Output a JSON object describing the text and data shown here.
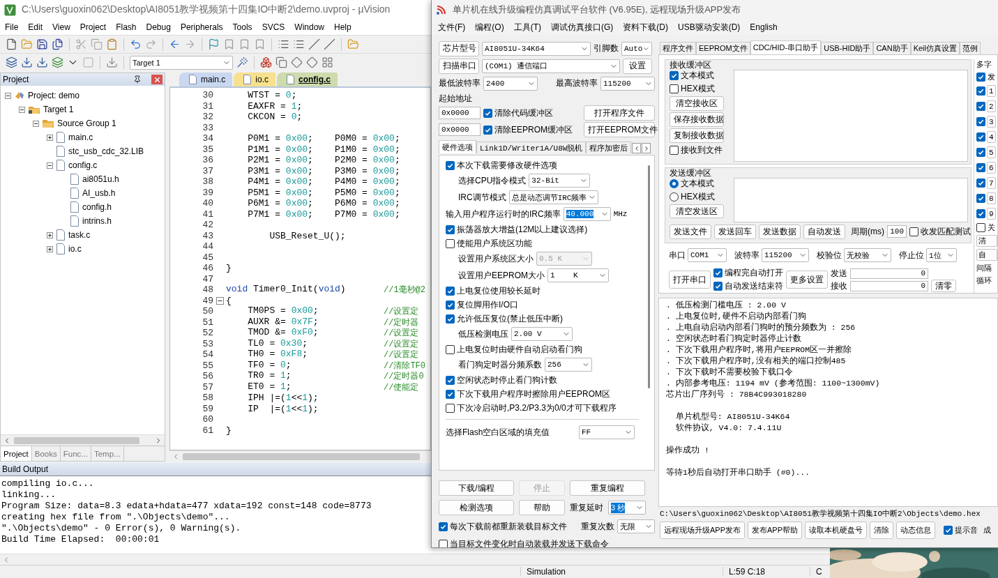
{
  "ide": {
    "title": "C:\\Users\\guoxin062\\Desktop\\AI8051教学视频第十四集IO中断2\\demo.uvproj - µVision",
    "menu": [
      "File",
      "Edit",
      "View",
      "Project",
      "Flash",
      "Debug",
      "Peripherals",
      "Tools",
      "SVCS",
      "Window",
      "Help"
    ],
    "target": "Target 1",
    "project_panel": {
      "title": "Project",
      "tree": [
        {
          "label": "Project: demo",
          "kind": "project",
          "expanded": true,
          "children": [
            {
              "label": "Target 1",
              "kind": "target",
              "expanded": true,
              "children": [
                {
                  "label": "Source Group 1",
                  "kind": "group",
                  "expanded": true,
                  "children": [
                    {
                      "label": "main.c",
                      "kind": "file",
                      "expanded": false
                    },
                    {
                      "label": "stc_usb_cdc_32.LIB",
                      "kind": "file"
                    },
                    {
                      "label": "config.c",
                      "kind": "file",
                      "expanded": true,
                      "children": [
                        {
                          "label": "ai8051u.h",
                          "kind": "file"
                        },
                        {
                          "label": "AI_usb.h",
                          "kind": "file"
                        },
                        {
                          "label": "config.h",
                          "kind": "file"
                        },
                        {
                          "label": "intrins.h",
                          "kind": "file"
                        }
                      ]
                    },
                    {
                      "label": "task.c",
                      "kind": "file",
                      "expanded": false
                    },
                    {
                      "label": "io.c",
                      "kind": "file",
                      "expanded": false
                    }
                  ]
                }
              ]
            }
          ]
        }
      ],
      "tabs": [
        {
          "label": "Project",
          "selected": true
        },
        {
          "label": "Books",
          "selected": false
        },
        {
          "label": "Func...",
          "selected": false
        },
        {
          "label": "Temp...",
          "selected": false
        }
      ]
    },
    "editor_tabs": [
      {
        "label": "main.c",
        "selected": false,
        "color": "#c9d8f0"
      },
      {
        "label": "io.c",
        "selected": false,
        "color": "#f7e08e"
      },
      {
        "label": "config.c",
        "selected": true,
        "color": "#cddbad"
      }
    ],
    "code_lines": [
      {
        "number": "30",
        "code": "    WTST = 0;"
      },
      {
        "number": "31",
        "code": "    EAXFR = 1;"
      },
      {
        "number": "32",
        "code": "    CKCON = 0;"
      },
      {
        "number": "33"
      },
      {
        "number": "34",
        "code": "    P0M1 = 0x00;    P0M0 = 0x00;"
      },
      {
        "number": "35",
        "code": "    P1M1 = 0x00;    P1M0 = 0x00;"
      },
      {
        "number": "36",
        "code": "    P2M1 = 0x00;    P2M0 = 0x00;"
      },
      {
        "number": "37",
        "code": "    P3M1 = 0x00;    P3M0 = 0x00;"
      },
      {
        "number": "38",
        "code": "    P4M1 = 0x00;    P4M0 = 0x00;"
      },
      {
        "number": "39",
        "code": "    P5M1 = 0x00;    P5M0 = 0x00;"
      },
      {
        "number": "40",
        "code": "    P6M1 = 0x00;    P6M0 = 0x00;"
      },
      {
        "number": "41",
        "code": "    P7M1 = 0x00;    P7M0 = 0x00;"
      },
      {
        "number": "42"
      },
      {
        "number": "43",
        "code": "        USB_Reset_U();"
      },
      {
        "number": "44"
      },
      {
        "number": "45"
      },
      {
        "number": "46",
        "code": "}"
      },
      {
        "number": "47"
      },
      {
        "number": "48",
        "tokens": [
          {
            "kind": "keyword",
            "text": "void"
          },
          {
            "kind": "plain",
            "text": " Timer0_Init("
          },
          {
            "kind": "keyword",
            "text": "void"
          },
          {
            "kind": "plain",
            "text": ")"
          }
        ],
        "comment": "//1毫秒@2"
      },
      {
        "number": "49",
        "code": "{",
        "folded": false
      },
      {
        "number": "50",
        "code": "    TM0PS = 0x00;",
        "comment": "//设置定"
      },
      {
        "number": "51",
        "code": "    AUXR &= 0x7F;",
        "comment": "//定时器"
      },
      {
        "number": "52",
        "code": "    TMOD &= 0xF0;",
        "comment": "//设置定"
      },
      {
        "number": "53",
        "code": "    TL0 = 0x30;",
        "comment": "//设置定"
      },
      {
        "number": "54",
        "code": "    TH0 = 0xF8;",
        "comment": "//设置定"
      },
      {
        "number": "55",
        "code": "    TF0 = 0;",
        "comment": "//清除TF0"
      },
      {
        "number": "56",
        "code": "    TR0 = 1;",
        "comment": "//定时器0"
      },
      {
        "number": "57",
        "code": "    ET0 = 1;",
        "comment": "//使能定"
      },
      {
        "number": "58",
        "code": "    IPH |=(1<<1);"
      },
      {
        "number": "59",
        "code": "    IP  |=(1<<1);"
      },
      {
        "number": "60"
      },
      {
        "number": "61",
        "code": "}"
      }
    ],
    "build_output": {
      "title": "Build Output",
      "lines": [
        "compiling io.c...",
        "linking...",
        "Program Size: data=8.3 edata+hdata=477 xdata=192 const=148 code=8773",
        "creating hex file from \".\\Objects\\demo\"...",
        "\".\\Objects\\demo\" - 0 Error(s), 0 Warning(s).",
        "Build Time Elapsed:  00:00:01"
      ]
    },
    "status_bar": [
      "Simulation",
      "L:59 C:18",
      "C"
    ]
  },
  "isp": {
    "title": "单片机在线升级编程仿真调试平台软件 (V6.95E), 远程现场升级APP发布",
    "menu": [
      "文件(F)",
      "编程(O)",
      "工具(T)",
      "调试仿真接口(G)",
      "资料下载(D)",
      "USB驱动安装(D)",
      "English"
    ],
    "chip": {
      "button": "芯片型号",
      "value": "AI8051U-34K64",
      "pins_label": "引脚数",
      "pins": "Auto"
    },
    "port": {
      "button": "扫描串口",
      "value": "(COM1) 通信端口",
      "settings": "设置"
    },
    "baud": {
      "min_label": "最低波特率",
      "min": "2400",
      "max_label": "最高波特率",
      "max": "115200"
    },
    "start_address": {
      "label": "起始地址",
      "rows": [
        {
          "value": "0x0000",
          "label": "清除代码缓冲区",
          "checked": true,
          "button": "打开程序文件"
        },
        {
          "value": "0x0000",
          "label": "清除EEPROM缓冲区",
          "checked": true,
          "button": "打开EEPROM文件"
        }
      ]
    },
    "option_tabs": [
      {
        "label": "硬件选项",
        "selected": true
      },
      {
        "label": "Link1D/Writer1A/U8W脱机",
        "selected": false
      },
      {
        "label": "程序加密后",
        "selected": false
      }
    ],
    "options": [
      {
        "kind": "check",
        "label": "本次下载需要修改硬件选项",
        "checked": true
      },
      {
        "kind": "select",
        "label": "选择CPU指令模式",
        "value": "32-Bit",
        "disabled": false,
        "highlighted": false
      },
      {
        "kind": "select",
        "label": "IRC调节模式",
        "value": "总是动态调节IRC频率",
        "disabled": false,
        "highlighted": false
      },
      {
        "kind": "select",
        "label": "输入用户程序运行时的IRC频率",
        "value": "40.000",
        "unit": "MHz",
        "disabled": false,
        "highlighted": true
      },
      {
        "kind": "check",
        "label": "振荡器放大增益(12M以上建议选择)",
        "checked": true
      },
      {
        "kind": "check",
        "label": "使能用户系统区功能",
        "checked": false
      },
      {
        "kind": "select",
        "label": "设置用户系统区大小",
        "value": "0.5 K",
        "disabled": true,
        "highlighted": false
      },
      {
        "kind": "select",
        "label": "设置用户EEPROM大小",
        "value": "1    K",
        "disabled": false,
        "highlighted": false
      },
      {
        "kind": "check",
        "label": "上电复位使用较长延时",
        "checked": true
      },
      {
        "kind": "check",
        "label": "复位脚用作I/O口",
        "checked": true
      },
      {
        "kind": "check",
        "label": "允许低压复位(禁止低压中断)",
        "checked": true
      },
      {
        "kind": "select",
        "label": "低压检测电压",
        "value": "2.00 V",
        "disabled": false,
        "highlighted": false
      },
      {
        "kind": "check",
        "label": "上电复位时由硬件自动启动看门狗",
        "checked": false
      },
      {
        "kind": "select",
        "label": "看门狗定时器分频系数",
        "value": "256",
        "disabled": false,
        "highlighted": false
      },
      {
        "kind": "check",
        "label": "空闲状态时停止看门狗计数",
        "checked": true
      },
      {
        "kind": "check",
        "label": "下次下载用户程序时擦除用户EEPROM区",
        "checked": true
      },
      {
        "kind": "check",
        "label": "下次冷启动时,P3.2/P3.3为0/0才可下载程序",
        "checked": false
      }
    ],
    "fill": {
      "label": "选择Flash空白区域的填充值",
      "value": "FF"
    },
    "actions": {
      "download": "下载/编程",
      "stop": "停止",
      "stop_disabled": true,
      "repeat": "重复编程",
      "detect": "检测选项",
      "help": "帮助",
      "delay_label": "重复延时",
      "delay": "3 秒",
      "count_label": "重复次数",
      "count": "无限",
      "reload": {
        "label": "每次下载前都重新装载目标文件",
        "checked": true
      },
      "auto": {
        "label": "当目标文件变化时自动装载并发送下载命令",
        "checked": false
      }
    },
    "tabs": [
      {
        "label": "程序文件",
        "selected": false
      },
      {
        "label": "EEPROM文件",
        "selected": false
      },
      {
        "label": "CDC/HID-串口助手",
        "selected": true
      },
      {
        "label": "USB-HID助手",
        "selected": false
      },
      {
        "label": "CAN助手",
        "selected": false
      },
      {
        "label": "Keil仿真设置",
        "selected": false
      },
      {
        "label": "范例",
        "selected": false
      }
    ],
    "receive": {
      "title": "接收缓冲区",
      "modes": [
        {
          "label": "文本模式",
          "checked": true
        },
        {
          "label": "HEX模式",
          "checked": false
        }
      ],
      "buttons": [
        "清空接收区",
        "保存接收数据",
        "复制接收数据"
      ],
      "to_file": {
        "label": "接收到文件",
        "checked": false
      }
    },
    "send": {
      "title": "发送缓冲区",
      "modes": [
        {
          "label": "文本模式",
          "selected": true
        },
        {
          "label": "HEX模式",
          "selected": false
        }
      ],
      "clear": "清空发送区",
      "buttons": [
        "发送文件",
        "发送回车",
        "发送数据",
        "自动发送"
      ],
      "period_label": "周期(ms)",
      "period": "100",
      "match": {
        "label": "收发匹配测试",
        "checked": false
      }
    },
    "serial": {
      "fields": [
        {
          "label": "串口",
          "value": "COM1"
        },
        {
          "label": "波特率",
          "value": "115200"
        },
        {
          "label": "校验位",
          "value": "无校验"
        },
        {
          "label": "停止位",
          "value": "1位"
        }
      ],
      "open": "打开串口",
      "checks": [
        {
          "label": "编程完自动打开",
          "checked": true
        },
        {
          "label": "自动发送结束符",
          "checked": true
        }
      ],
      "more": "更多设置",
      "counters": [
        {
          "label": "发送",
          "value": "0"
        },
        {
          "label": "接收",
          "value": "0"
        }
      ],
      "reset": "清零"
    },
    "multi": {
      "title": "多字",
      "header": {
        "label": "发",
        "checked": true
      },
      "rows": [
        {
          "label": "1",
          "checked": true
        },
        {
          "label": "2",
          "checked": true
        },
        {
          "label": "3",
          "checked": true
        },
        {
          "label": "4",
          "checked": true
        },
        {
          "label": "5",
          "checked": true
        },
        {
          "label": "6",
          "checked": true
        },
        {
          "label": "7",
          "checked": true
        },
        {
          "label": "8",
          "checked": true
        },
        {
          "label": "9",
          "checked": true
        }
      ],
      "close": {
        "label": "关",
        "checked": false
      },
      "buttons": [
        "清",
        "自"
      ],
      "labels": [
        "间隔",
        "循环"
      ]
    },
    "log": [
      {
        "lines": [
          ". 低压检测门槛电压 : 2.00 V",
          ". 上电复位时,硬件不启动内部看门狗",
          ". 上电自动启动内部看门狗时的预分频数为 : 256",
          ". 空闲状态时看门狗定时器停止计数",
          ". 下次下载用户程序时,将用户EEPROM区一并擦除",
          ". 下次下载用户程序时,没有相关的端口控制485",
          ". 下次下载时不需要校验下载口令",
          ". 内部参考电压: 1194 mV (参考范围: 1100~1300mV)",
          "芯片出厂序列号 : 78B4C993018280"
        ]
      },
      {
        "lines": [
          "  单片机型号: AI8051U-34K64",
          "  软件协议, V4.0: 7.4.11U"
        ]
      },
      {
        "lines": [
          "操作成功 !"
        ]
      },
      {
        "lines": [
          "等待1秒后自动打开串口助手 (#0)..."
        ]
      }
    ],
    "hex_path": "C:\\Users\\guoxin062\\Desktop\\AI8051教学视频第十四集IO中断2\\Objects\\demo.hex",
    "bottom_buttons": [
      "远程现场升级APP发布",
      "发布APP帮助",
      "读取本机硬盘号",
      "清除",
      "动态信息"
    ],
    "beep": {
      "label": "提示音",
      "checked": true
    },
    "edge_text": "成"
  }
}
